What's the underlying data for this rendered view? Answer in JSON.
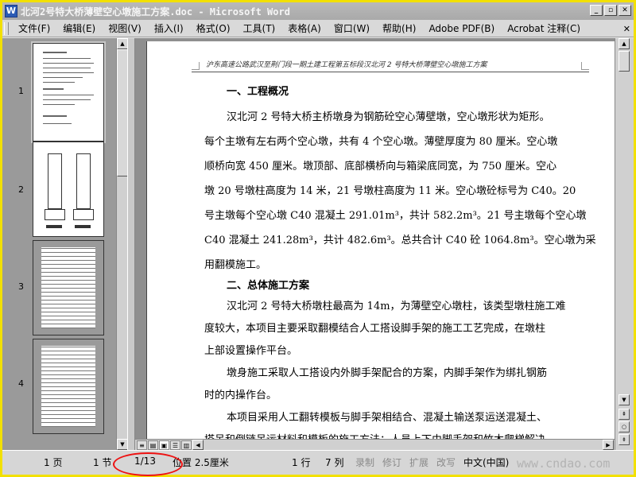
{
  "window": {
    "title": "北河2号特大桥薄壁空心墩施工方案.doc - Microsoft Word",
    "app_icon": "W"
  },
  "menu": [
    "文件(F)",
    "编辑(E)",
    "视图(V)",
    "插入(I)",
    "格式(O)",
    "工具(T)",
    "表格(A)",
    "窗口(W)",
    "帮助(H)",
    "Adobe PDF(B)",
    "Acrobat 注释(C)"
  ],
  "thumbnails": [
    "1",
    "2",
    "3",
    "4"
  ],
  "document": {
    "header": "沪东高速公路武汉至荆门段一期土建工程第五标段汉北河 2 号特大桥薄壁空心墩施工方案",
    "section1_title": "一、工程概况",
    "lines1": [
      "汉北河 2 号特大桥主桥墩身为钢筋砼空心薄壁墩，空心墩形状为矩形。",
      "每个主墩有左右两个空心墩，共有 4 个空心墩。薄壁厚度为 80 厘米。空心墩",
      "顺桥向宽 450 厘米。墩顶部、底部横桥向与箱梁底同宽，为 750 厘米。空心",
      "墩 20 号墩柱高度为 14 米，21 号墩柱高度为 11 米。空心墩砼标号为 C40。20",
      "号主墩每个空心墩 C40 混凝土 291.01m³，共计 582.2m³。21 号主墩每个空心墩",
      "C40 混凝土 241.28m³，共计 482.6m³。总共合计 C40 砼 1064.8m³。空心墩为采",
      "用翻模施工。"
    ],
    "section2_title": "二、总体施工方案",
    "lines2": [
      "汉北河 2 号特大桥墩柱最高为 14m，为薄壁空心墩柱，该类型墩柱施工难",
      "度较大，本项目主要采取翻模结合人工搭设脚手架的施工工艺完成，在墩柱",
      "上部设置操作平台。",
      "墩身施工采取人工搭设内外脚手架配合的方案，内脚手架作为绑扎钢筋",
      "时的内操作台。",
      "本项目采用人工翻转模板与脚手架相结合、混凝土输送泵运送混凝土、",
      "塔吊和倒链吊运材料和模板的施工方法；人员上下由脚手架和竹木爬梯解决，"
    ]
  },
  "status": {
    "page": "1 页",
    "section": "1 节",
    "page_of": "1/13",
    "position": "位置 2.5厘米",
    "line": "1 行",
    "column": "7 列",
    "rec": "录制",
    "trk": "修订",
    "ext": "扩展",
    "ovr": "改写",
    "lang": "中文(中国)"
  },
  "watermark": "www.cndao.com"
}
